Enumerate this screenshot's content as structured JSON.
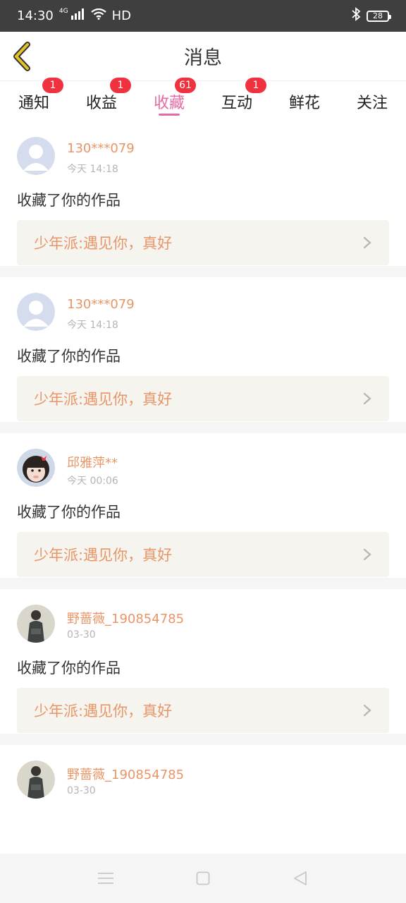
{
  "status_bar": {
    "time": "14:30",
    "network_type": "4G",
    "hd_label": "HD",
    "battery": "28"
  },
  "header": {
    "title": "消息"
  },
  "tabs": [
    {
      "label": "通知",
      "badge": "1",
      "active": false
    },
    {
      "label": "收益",
      "badge": "1",
      "active": false
    },
    {
      "label": "收藏",
      "badge": "61",
      "active": true
    },
    {
      "label": "互动",
      "badge": "1",
      "active": false
    },
    {
      "label": "鲜花",
      "badge": "",
      "active": false
    },
    {
      "label": "关注",
      "badge": "",
      "active": false
    }
  ],
  "feed": [
    {
      "username": "130***079",
      "time": "今天 14:18",
      "action": "收藏了你的作品",
      "work_title": "少年派:遇见你，真好",
      "avatar": "default-avatar"
    },
    {
      "username": "130***079",
      "time": "今天 14:18",
      "action": "收藏了你的作品",
      "work_title": "少年派:遇见你，真好",
      "avatar": "default-avatar"
    },
    {
      "username": "邱雅萍**",
      "time": "今天 00:06",
      "action": "收藏了你的作品",
      "work_title": "少年派:遇见你，真好",
      "avatar": "child-photo-avatar"
    },
    {
      "username": "野蔷薇_190854785",
      "time": "03-30",
      "action": "收藏了你的作品",
      "work_title": "少年派:遇见你，真好",
      "avatar": "person-photo-avatar"
    },
    {
      "username": "野蔷薇_190854785",
      "time": "03-30",
      "action": "",
      "work_title": "",
      "avatar": "person-photo-avatar"
    }
  ],
  "colors": {
    "accent_pink": "#e96aa3",
    "username_orange": "#e99567",
    "badge_red": "#f0313f",
    "back_icon_yellow": "#e6c229"
  }
}
